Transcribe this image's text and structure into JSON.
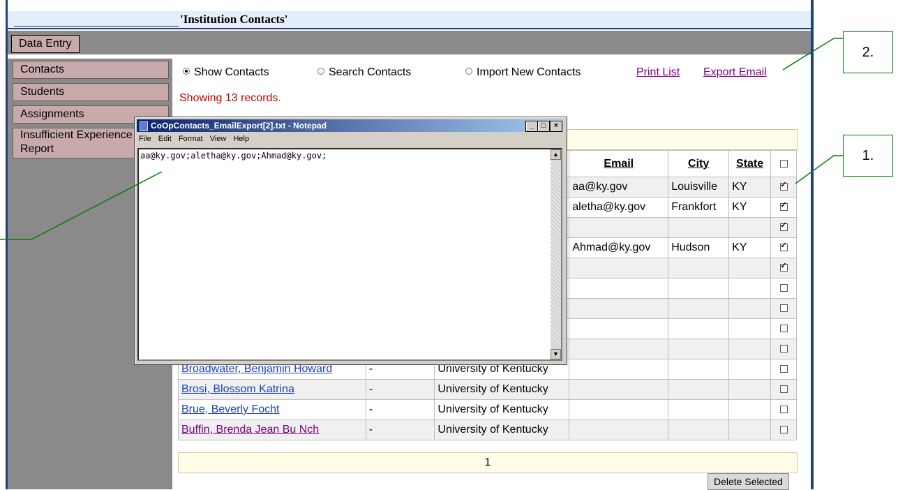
{
  "page_title": "'Institution Contacts'",
  "toolbar": {
    "data_entry_label": "Data Entry"
  },
  "sidebar": {
    "items": [
      {
        "label": "Contacts"
      },
      {
        "label": "Students"
      },
      {
        "label": "Assignments"
      },
      {
        "label": "Insufficient Experience"
      },
      {
        "label": "Report"
      }
    ]
  },
  "view_options": {
    "show_contacts": "Show Contacts",
    "search_contacts": "Search Contacts",
    "import_contacts": "Import New Contacts",
    "selected": "show_contacts"
  },
  "links": {
    "print_list": "Print List",
    "export_email": "Export Email"
  },
  "status": {
    "prefix": "Showing ",
    "count": "13",
    "suffix": " records."
  },
  "table": {
    "headers": {
      "email": "Email",
      "city": "City",
      "state": "State"
    },
    "rows": [
      {
        "name": "",
        "dash": "",
        "institution": "",
        "email": "aa@ky.gov",
        "city": "Louisville",
        "state": "KY",
        "checked": true
      },
      {
        "name": "",
        "dash": "",
        "institution": "",
        "email": "aletha@ky.gov",
        "city": "Frankfort",
        "state": "KY",
        "checked": true
      },
      {
        "name": "",
        "dash": "",
        "institution": "",
        "email": "",
        "city": "",
        "state": "",
        "checked": true
      },
      {
        "name": "",
        "dash": "",
        "institution": "",
        "email": "Ahmad@ky.gov",
        "city": "Hudson",
        "state": "KY",
        "checked": true
      },
      {
        "name": "",
        "dash": "",
        "institution": "",
        "email": "",
        "city": "",
        "state": "",
        "checked": true
      },
      {
        "name": "",
        "dash": "",
        "institution": "",
        "email": "",
        "city": "",
        "state": "",
        "checked": false
      },
      {
        "name": "",
        "dash": "",
        "institution": "",
        "email": "",
        "city": "",
        "state": "",
        "checked": false
      },
      {
        "name": "",
        "dash": "",
        "institution": "",
        "email": "",
        "city": "",
        "state": "",
        "checked": false
      },
      {
        "name": "",
        "dash": "",
        "institution": "",
        "email": "",
        "city": "",
        "state": "",
        "checked": false
      },
      {
        "name": "Broadwater, Benjamin Howard",
        "dash": "-",
        "institution": "University of Kentucky",
        "email": "",
        "city": "",
        "state": "",
        "checked": false
      },
      {
        "name": "Brosi, Blossom Katrina",
        "dash": "-",
        "institution": "University of Kentucky",
        "email": "",
        "city": "",
        "state": "",
        "checked": false
      },
      {
        "name": "Brue, Beverly Focht",
        "dash": "-",
        "institution": "University of Kentucky",
        "email": "",
        "city": "",
        "state": "",
        "checked": false
      },
      {
        "name": "Buffin, Brenda Jean Bu Nch",
        "dash": "-",
        "institution": "University of Kentucky",
        "email": "",
        "city": "",
        "state": "",
        "checked": false,
        "visited": true
      }
    ],
    "pager": "1",
    "delete_label": "Delete Selected"
  },
  "notepad": {
    "title": "CoOpContacts_EmailExport[2].txt - Notepad",
    "menu": [
      "File",
      "Edit",
      "Format",
      "View",
      "Help"
    ],
    "content": "aa@ky.gov;aletha@ky.gov;Ahmad@ky.gov;",
    "min_glyph": "_",
    "max_glyph": "□",
    "close_glyph": "×"
  },
  "callouts": {
    "one": "1.",
    "two": "2."
  },
  "colors": {
    "frame": "#1f3f7f",
    "nav_button": "#c8aaaa",
    "sidebar_bg": "#8a8a8a",
    "link_visited": "#800080",
    "link": "#1c3fb5",
    "status_red": "#c00000",
    "callout_line": "#0a7a0a"
  }
}
